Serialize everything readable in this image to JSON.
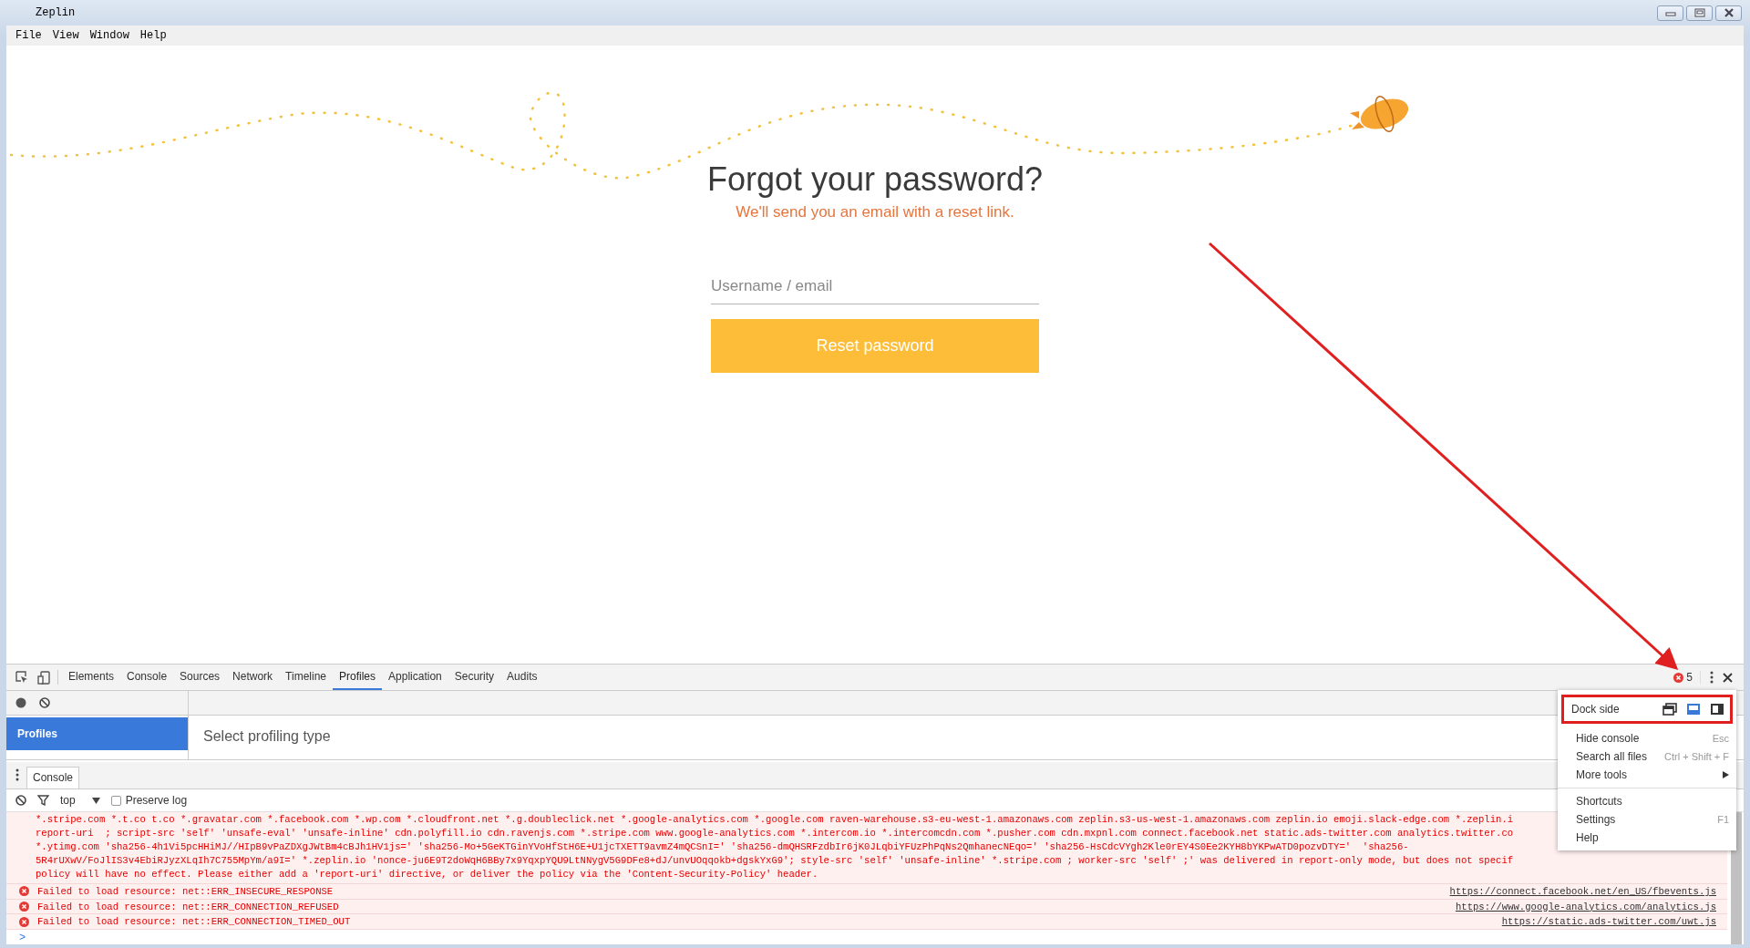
{
  "window": {
    "title": "Zeplin",
    "menu": [
      "File",
      "View",
      "Window",
      "Help"
    ]
  },
  "page": {
    "heading": "Forgot your password?",
    "subheading": "We'll send you an email with a reset link.",
    "username_field": {
      "placeholder": "Username / email"
    },
    "button": "Reset password"
  },
  "devtools": {
    "tabs": [
      {
        "label": "Elements",
        "selected": false
      },
      {
        "label": "Console",
        "selected": false
      },
      {
        "label": "Sources",
        "selected": false
      },
      {
        "label": "Network",
        "selected": false
      },
      {
        "label": "Timeline",
        "selected": false
      },
      {
        "label": "Profiles",
        "selected": true
      },
      {
        "label": "Application",
        "selected": false
      },
      {
        "label": "Security",
        "selected": false
      },
      {
        "label": "Audits",
        "selected": false
      }
    ],
    "error_count": "5",
    "sidebar": [
      {
        "label": "Profiles",
        "selected": true
      }
    ],
    "panel_text": "Select profiling type",
    "drawer_tab": "Console",
    "context": "top",
    "preserve_log": {
      "label": "Preserve log",
      "checked": false
    },
    "messages": [
      {
        "kind": "continued",
        "lines": [
          "*.stripe.com *.t.co t.co *.gravatar.com *.facebook.com *.wp.com *.cloudfront.net *.g.doubleclick.net *.google-analytics.com *.google.com raven-warehouse.s3-eu-west-1.amazonaws.com zeplin.s3-us-west-1.amazonaws.com zeplin.io emoji.slack-edge.com *.zeplin.i",
          "report-uri  ; script-src 'self' 'unsafe-eval' 'unsafe-inline' cdn.polyfill.io cdn.ravenjs.com *.stripe.com www.google-analytics.com *.intercom.io *.intercomcdn.com *.pusher.com cdn.mxpnl.com connect.facebook.net static.ads-twitter.com analytics.twitter.co",
          "*.ytimg.com 'sha256-4h1Vi5pcHHiMJ//HIpB9vPaZDXgJWtBm4cBJh1HV1js=' 'sha256-Mo+5GeKTGinYVoHfStH6E+U1jcTXETT9avmZ4mQCSnI=' 'sha256-dmQHSRFzdbIr6jK0JLqbiYFUzPhPqNs2QmhanecNEqo=' 'sha256-HsCdcVYgh2Kle0rEY4S0Ee2KYH8bYKPwATD0pozvDTY='  'sha256-",
          "5R4rUXwV/FoJlIS3v4EbiRJyzXLqIh7C755MpYm/a9I=' *.zeplin.io 'nonce-ju6E9T2doWqH6BBy7x9YqxpYQU9LtNNygV5G9DFe8+dJ/unvUOqqokb+dgskYxG9'; style-src 'self' 'unsafe-inline' *.stripe.com ; worker-src 'self' ;' was delivered in report-only mode, but does not specif",
          "policy will have no effect. Please either add a 'report-uri' directive, or deliver the policy via the 'Content-Security-Policy' header."
        ]
      },
      {
        "kind": "error",
        "text": "Failed to load resource: net::ERR_INSECURE_RESPONSE",
        "source": "https://connect.facebook.net/en_US/fbevents.js"
      },
      {
        "kind": "error",
        "text": "Failed to load resource: net::ERR_CONNECTION_REFUSED",
        "source": "https://www.google-analytics.com/analytics.js"
      },
      {
        "kind": "error",
        "text": "Failed to load resource: net::ERR_CONNECTION_TIMED_OUT",
        "source": "https://static.ads-twitter.com/uwt.js"
      }
    ],
    "prompt": ">",
    "menu": {
      "dock_label": "Dock side",
      "dock_options": [
        {
          "kind": "undock",
          "selected": false
        },
        {
          "kind": "bottom",
          "selected": true
        },
        {
          "kind": "right",
          "selected": false
        }
      ],
      "groups": [
        [
          {
            "label": "Hide console",
            "shortcut": "Esc",
            "submenu": false
          },
          {
            "label": "Search all files",
            "shortcut": "Ctrl + Shift + F",
            "submenu": false
          },
          {
            "label": "More tools",
            "submenu": true
          }
        ],
        [
          {
            "label": "Shortcuts",
            "submenu": false
          },
          {
            "label": "Settings",
            "shortcut": "F1",
            "submenu": false
          },
          {
            "label": "Help",
            "submenu": false
          }
        ]
      ]
    }
  }
}
